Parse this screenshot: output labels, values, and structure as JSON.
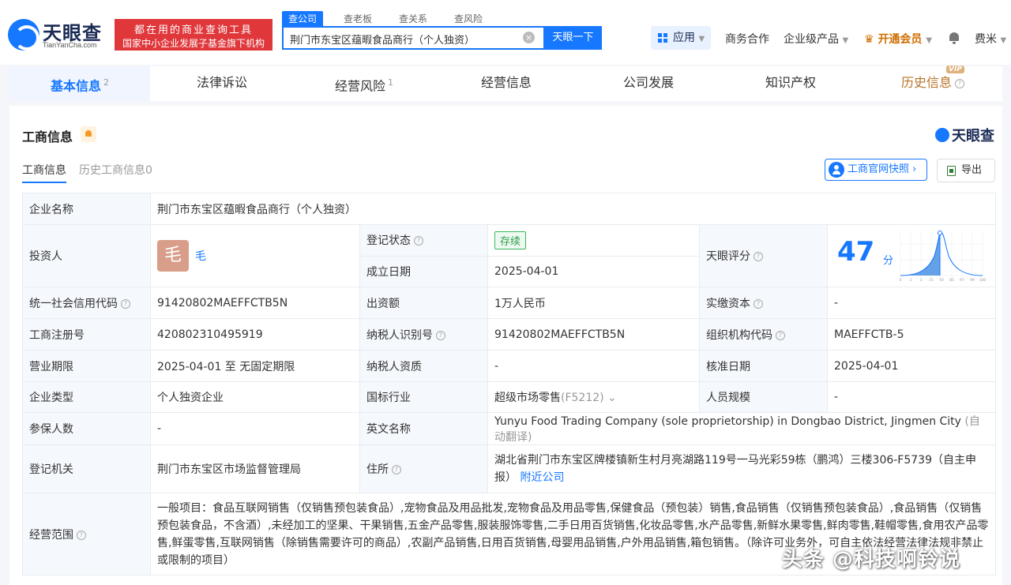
{
  "header": {
    "logo_text": "天眼查",
    "logo_sub": "TianYanCha.com",
    "slogan_line1": "都在用的商业查询工具",
    "slogan_line2": "国家中小企业发展子基金旗下机构",
    "search_tabs": [
      "查公司",
      "查老板",
      "查关系",
      "查风险"
    ],
    "search_value": "荆门市东宝区蕴暇食品商行（个人独资）",
    "search_button": "天眼一下",
    "nav_apps": "应用",
    "nav_cooperation": "商务合作",
    "nav_enterprise": "企业级产品",
    "nav_vip": "开通会员",
    "nav_user": "费米"
  },
  "tabs": [
    {
      "label": "基本信息",
      "count": "2"
    },
    {
      "label": "法律诉讼",
      "count": ""
    },
    {
      "label": "经营风险",
      "count": "1"
    },
    {
      "label": "经营信息",
      "count": ""
    },
    {
      "label": "公司发展",
      "count": ""
    },
    {
      "label": "知识产权",
      "count": ""
    },
    {
      "label": "历史信息",
      "count": ""
    }
  ],
  "vip_badge": "VIP",
  "section": {
    "title": "工商信息",
    "brand": "天眼查",
    "subtabs": [
      "工商信息",
      "历史工商信息0"
    ],
    "snapshot_button": "工商官网快照",
    "export_button": "导出"
  },
  "info": {
    "company_name_label": "企业名称",
    "company_name": "荆门市东宝区蕴暇食品商行（个人独资）",
    "investor_label": "投资人",
    "investor_avatar": "毛",
    "investor_name": "毛",
    "status_label": "登记状态",
    "status": "存续",
    "found_label": "成立日期",
    "found_date": "2025-04-01",
    "score_label": "天眼评分",
    "score": "47",
    "score_unit": "分",
    "score_axis": [
      "0",
      "1",
      "3",
      "15",
      "50",
      "85",
      "97",
      "99",
      "100"
    ],
    "credit_label": "统一社会信用代码",
    "credit_code": "91420802MAEFFCTB5N",
    "capital_label": "出资额",
    "capital": "1万人民币",
    "paid_label": "实缴资本",
    "paid": "-",
    "reg_no_label": "工商注册号",
    "reg_no": "420802310495919",
    "taxpayer_label": "纳税人识别号",
    "taxpayer_no": "91420802MAEFFCTB5N",
    "org_label": "组织机构代码",
    "org_code": "MAEFFCTB-5",
    "term_label": "营业期限",
    "term": "2025-04-01 至 无固定期限",
    "tax_qual_label": "纳税人资质",
    "tax_qual": "-",
    "approve_label": "核准日期",
    "approve_date": "2025-04-01",
    "type_label": "企业类型",
    "type": "个人独资企业",
    "industry_label": "国标行业",
    "industry": "超级市场零售",
    "industry_code": "(F5212)",
    "staff_label": "人员规模",
    "staff": "-",
    "insured_label": "参保人数",
    "insured": "-",
    "english_label": "英文名称",
    "english_name": "Yunyu Food Trading Company (sole proprietorship) in Dongbao District, Jingmen City",
    "auto_translate": "(自动翻译)",
    "authority_label": "登记机关",
    "authority": "荆门市东宝区市场监督管理局",
    "address_label": "住所",
    "address": "湖北省荆门市东宝区牌楼镇新生村月亮湖路119号一马光彩59栋（鹏鸿）三楼306-F5739（自主申报）",
    "nearby": "附近公司",
    "scope_label": "经营范围",
    "scope": "一般项目：食品互联网销售（仅销售预包装食品）,宠物食品及用品批发,宠物食品及用品零售,保健食品（预包装）销售,食品销售（仅销售预包装食品）,食品销售（仅销售预包装食品，不含酒）,未经加工的坚果、干果销售,五金产品零售,服装服饰零售,二手日用百货销售,化妆品零售,水产品零售,新鲜水果零售,鲜肉零售,鞋帽零售,食用农产品零售,鲜蛋零售,互联网销售（除销售需要许可的商品）,农副产品销售,日用百货销售,母婴用品销售,户外用品销售,箱包销售。（除许可业务外，可自主依法经营法律法规非禁止或限制的项目）"
  },
  "watermark": "头条 @科技啊铃说",
  "colors": {
    "accent": "#1677ff",
    "slogan": "#e0373b",
    "status": "#2e9b4a"
  }
}
